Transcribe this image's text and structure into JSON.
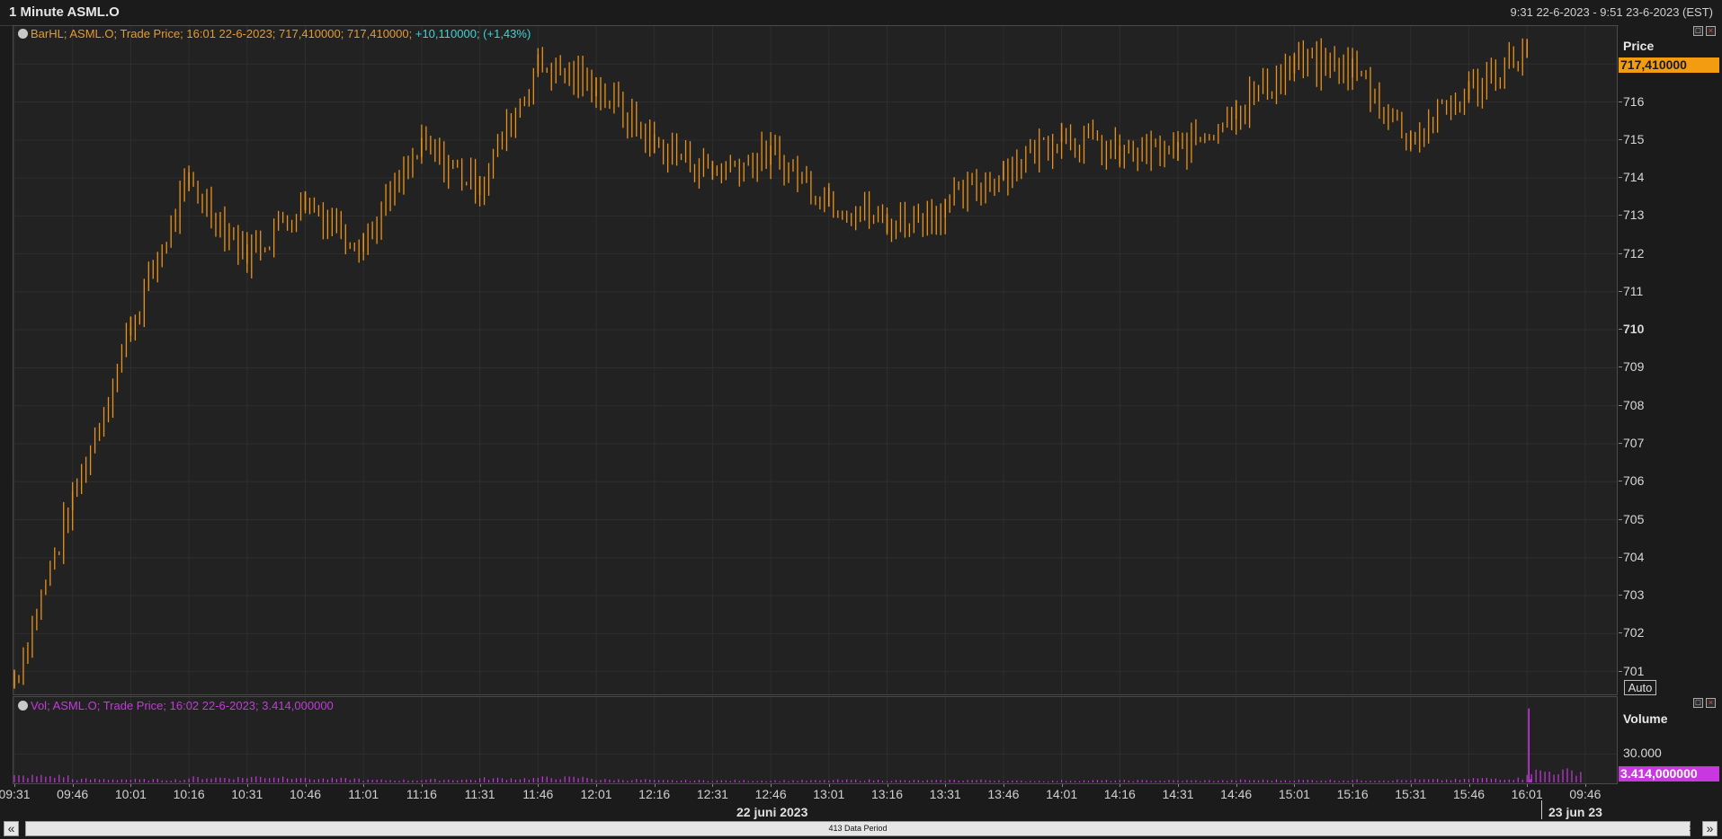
{
  "window": {
    "title": "1 Minute ASML.O",
    "range": "9:31 22-6-2023 - 9:51 23-6-2023 (EST)"
  },
  "price_panel": {
    "legend": {
      "prefix": "BarHL; ASML.O; Trade Price; 16:01 22-6-2023; 717,410000; 717,410000;",
      "change": "+10,110000; (+1,43%)"
    },
    "axis_title": "Price",
    "last_value": "717,410000",
    "auto_label": "Auto"
  },
  "volume_panel": {
    "legend": "Vol; ASML.O; Trade Price; 16:02 22-6-2023; 3.414,000000",
    "axis_title": "Volume",
    "last_value": "3.414,000000"
  },
  "x_axis": {
    "ticks": [
      "09:31",
      "09:46",
      "10:01",
      "10:16",
      "10:31",
      "10:46",
      "11:01",
      "11:16",
      "11:31",
      "11:46",
      "12:01",
      "12:16",
      "12:31",
      "12:46",
      "13:01",
      "13:16",
      "13:31",
      "13:46",
      "14:01",
      "14:16",
      "14:31",
      "14:46",
      "15:01",
      "15:16",
      "15:31",
      "15:46",
      "16:01",
      "09:46"
    ],
    "date_labels": [
      "22 juni 2023",
      "23 jun 23"
    ]
  },
  "scrollbar": {
    "label": "413 Data Period"
  },
  "colors": {
    "bars": "#e8921b",
    "volume": "#c837e0",
    "legend_price": "#e89a2a",
    "legend_change": "#3ad6d6",
    "last_value_bg": "#f39c12",
    "volume_badge_bg": "#c837e0",
    "grid": "#2e2e2e"
  },
  "chart_data": [
    {
      "type": "bar",
      "style": "high-low bars",
      "title": "BarHL; ASML.O; Trade Price",
      "ylabel": "Price",
      "ylim": [
        700.4,
        718.0
      ],
      "yticks": [
        701,
        702,
        703,
        704,
        705,
        706,
        707,
        708,
        709,
        710,
        711,
        712,
        713,
        714,
        715,
        716,
        717
      ],
      "x": [
        "09:31",
        "09:46",
        "10:01",
        "10:16",
        "10:31",
        "10:46",
        "11:01",
        "11:16",
        "11:31",
        "11:46",
        "12:01",
        "12:16",
        "12:31",
        "12:46",
        "13:01",
        "13:16",
        "13:31",
        "13:46",
        "14:01",
        "14:16",
        "14:31",
        "14:46",
        "15:01",
        "15:16",
        "15:31",
        "15:46",
        "16:01"
      ],
      "series": [
        {
          "name": "ASML.O",
          "values": [
            700.8,
            705.5,
            710.1,
            713.9,
            712.0,
            713.4,
            712.3,
            714.8,
            713.8,
            717.0,
            716.4,
            714.9,
            714.2,
            714.6,
            713.5,
            712.8,
            713.2,
            714.2,
            715.2,
            714.6,
            714.7,
            715.8,
            717.0,
            716.9,
            715.0,
            716.3,
            717.41
          ]
        }
      ]
    },
    {
      "type": "bar",
      "title": "Vol; ASML.O; Trade Price",
      "ylabel": "Volume",
      "yticks": [
        30000
      ],
      "ylim": [
        0,
        90000
      ],
      "x": [
        "09:31",
        "09:46",
        "10:01",
        "10:16",
        "10:31",
        "10:46",
        "11:01",
        "11:16",
        "11:31",
        "11:46",
        "12:01",
        "12:16",
        "12:31",
        "12:46",
        "13:01",
        "13:16",
        "13:31",
        "13:46",
        "14:01",
        "14:16",
        "14:31",
        "14:46",
        "15:01",
        "15:16",
        "15:31",
        "15:46",
        "16:01",
        "16:02"
      ],
      "series": [
        {
          "name": "ASML.O",
          "values": [
            8000,
            4000,
            3500,
            6000,
            7000,
            4500,
            3000,
            3500,
            5000,
            6000,
            3500,
            2500,
            2500,
            2500,
            3000,
            2500,
            3000,
            2000,
            2500,
            2500,
            2500,
            3000,
            3000,
            3000,
            3500,
            5000,
            14000,
            3414
          ]
        }
      ]
    }
  ]
}
